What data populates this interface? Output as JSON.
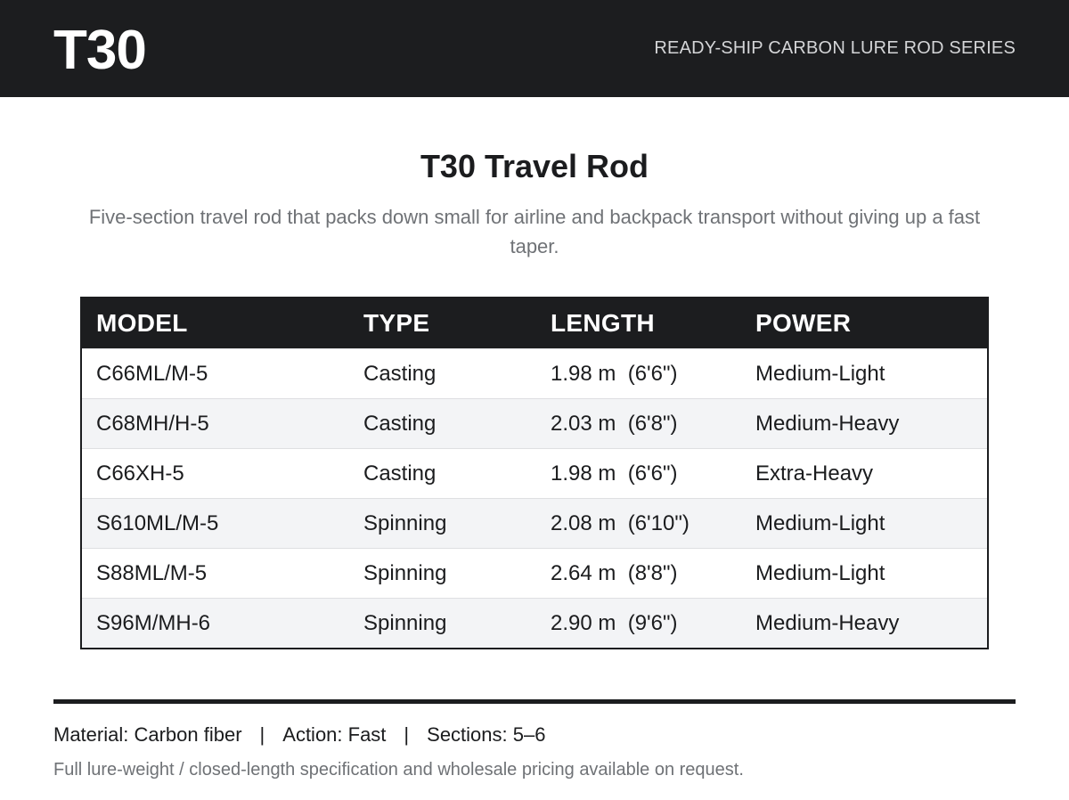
{
  "header": {
    "brand": "T30",
    "series": "READY-SHIP CARBON LURE ROD SERIES"
  },
  "product": {
    "title": "T30 Travel Rod",
    "description": "Five-section travel rod that packs down small for airline and backpack transport without giving up a fast taper."
  },
  "table": {
    "columns": [
      "MODEL",
      "TYPE",
      "LENGTH",
      "POWER"
    ],
    "rows": [
      {
        "model": "C66ML/M-5",
        "type": "Casting",
        "length": "1.98 m  (6'6\")",
        "power": "Medium-Light"
      },
      {
        "model": "C68MH/H-5",
        "type": "Casting",
        "length": "2.03 m  (6'8\")",
        "power": "Medium-Heavy"
      },
      {
        "model": "C66XH-5",
        "type": "Casting",
        "length": "1.98 m  (6'6\")",
        "power": "Extra-Heavy"
      },
      {
        "model": "S610ML/M-5",
        "type": "Spinning",
        "length": "2.08 m  (6'10\")",
        "power": "Medium-Light"
      },
      {
        "model": "S88ML/M-5",
        "type": "Spinning",
        "length": "2.64 m  (8'8\")",
        "power": "Medium-Light"
      },
      {
        "model": "S96M/MH-6",
        "type": "Spinning",
        "length": "2.90 m  (9'6\")",
        "power": "Medium-Heavy"
      }
    ]
  },
  "specs": {
    "material": "Material: Carbon fiber",
    "action": "Action: Fast",
    "sections": "Sections: 5–6",
    "separator": "|"
  },
  "note": "Full lure-weight / closed-length specification and wholesale pricing available on request.",
  "colors": {
    "header_bg": "#1c1d1f",
    "row_alt": "#f3f4f6",
    "muted_text": "#6f7276"
  }
}
